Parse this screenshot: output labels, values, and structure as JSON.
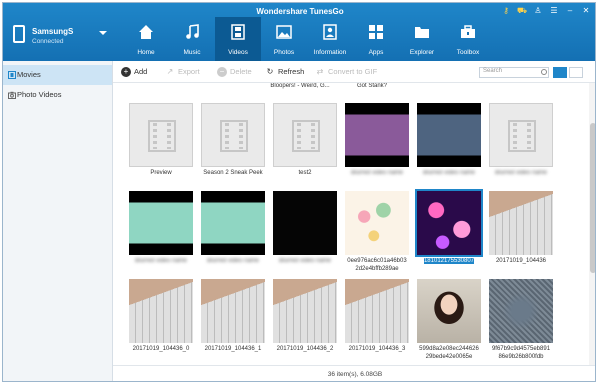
{
  "app": {
    "title": "Wondershare TunesGo"
  },
  "device": {
    "name": "SamsungS",
    "status": "Connected"
  },
  "nav": [
    {
      "label": "Home",
      "icon": "home-icon"
    },
    {
      "label": "Music",
      "icon": "music-icon"
    },
    {
      "label": "Videos",
      "icon": "film-icon"
    },
    {
      "label": "Photos",
      "icon": "photo-icon"
    },
    {
      "label": "Information",
      "icon": "contact-icon"
    },
    {
      "label": "Apps",
      "icon": "apps-icon"
    },
    {
      "label": "Explorer",
      "icon": "folder-icon"
    },
    {
      "label": "Toolbox",
      "icon": "toolbox-icon"
    }
  ],
  "sidebar": {
    "items": [
      {
        "label": "Movies",
        "icon": "film-icon"
      },
      {
        "label": "Photo Videos",
        "icon": "camera-icon"
      }
    ]
  },
  "toolbar": {
    "add": "Add",
    "export": "Export",
    "delete": "Delete",
    "refresh": "Refresh",
    "convert": "Convert to GIF"
  },
  "search": {
    "placeholder": "Search"
  },
  "top_captions": [
    "Bloopers! - Weird, G...",
    "Got Stank?"
  ],
  "videos": [
    {
      "caption": "Preview",
      "blurred": false
    },
    {
      "caption": "Season 2 Sneak Peek",
      "blurred": false
    },
    {
      "caption": "test2",
      "blurred": false
    },
    {
      "caption": "Blurred video name",
      "blurred": true
    },
    {
      "caption": "Blurred video name",
      "blurred": true
    },
    {
      "caption": "Blurred video name",
      "blurred": true
    },
    {
      "caption": "Blurred video name",
      "blurred": true
    },
    {
      "caption": "Blurred video name",
      "blurred": true
    },
    {
      "caption": "Blurred video name",
      "blurred": true
    },
    {
      "caption": "0ee976ac6c01a46b032d2e4bffb289ae",
      "caption_lines": [
        "0ee976ac6c01a46b03",
        "2d2e4bffb289ae"
      ],
      "blurred": false
    },
    {
      "caption": "181012175530807",
      "blurred": false,
      "selected": true
    },
    {
      "caption": "20171019_104436",
      "blurred": false
    },
    {
      "caption": "20171019_104436_0",
      "blurred": false
    },
    {
      "caption": "20171019_104436_1",
      "blurred": false
    },
    {
      "caption": "20171019_104436_2",
      "blurred": false
    },
    {
      "caption": "20171019_104436_3",
      "blurred": false
    },
    {
      "caption": "599d8a2e08ec24462629bede42e0065e",
      "caption_lines": [
        "599d8a2e08ec244626",
        "29bede42e0065e"
      ],
      "blurred": false
    },
    {
      "caption": "9f67b9c9d4575eb89186e9b26b800fdb",
      "caption_lines": [
        "9f67b9c9d4575eb891",
        "86e9b26b800fdb"
      ],
      "blurred": false
    }
  ],
  "status": {
    "text": "36 item(s), 6.08GB"
  },
  "colors": {
    "header": "#1f86c9",
    "selection": "#1f86c9",
    "active_nav": "#0c5a93"
  }
}
